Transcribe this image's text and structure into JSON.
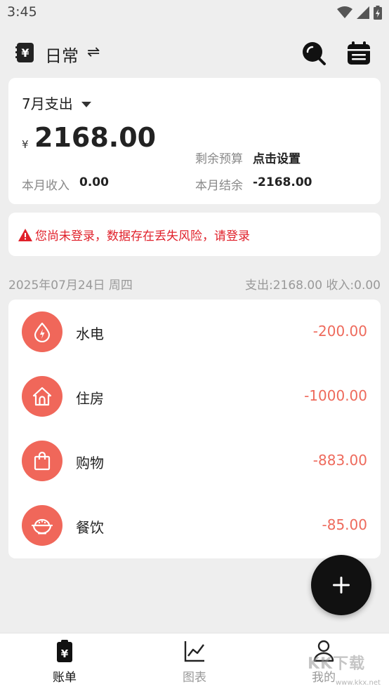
{
  "status_bar": {
    "time": "3:45"
  },
  "header": {
    "title": "日常",
    "swap_glyph": "⇌",
    "book_glyph": "¥"
  },
  "summary": {
    "month_label": "7月支出",
    "currency": "¥",
    "total": "2168.00",
    "budget_label": "剩余预算",
    "budget_action": "点击设置",
    "income_label": "本月收入",
    "income_value": "0.00",
    "balance_label": "本月结余",
    "balance_value": "-2168.00"
  },
  "warning": {
    "icon": "warning-icon",
    "text": "您尚未登录，数据存在丢失风险，请登录"
  },
  "day": {
    "date": "2025年07月24日 周四",
    "totals": "支出:2168.00  收入:0.00"
  },
  "records": [
    {
      "label": "水电",
      "amount": "-200.00",
      "icon": "utilities-icon"
    },
    {
      "label": "住房",
      "amount": "-1000.00",
      "icon": "house-icon"
    },
    {
      "label": "购物",
      "amount": "-883.00",
      "icon": "shopping-bag-icon"
    },
    {
      "label": "餐饮",
      "amount": "-85.00",
      "icon": "food-bowl-icon"
    }
  ],
  "nav": [
    {
      "label": "账单",
      "icon": "bill-icon",
      "active": true
    },
    {
      "label": "图表",
      "icon": "chart-icon",
      "active": false
    },
    {
      "label": "我的",
      "icon": "profile-icon",
      "active": false
    }
  ],
  "watermark": {
    "text": "KK下载",
    "url": "www.kkx.net"
  },
  "colors": {
    "accent": "#f0675a",
    "amount": "#ee6a5c",
    "warning": "#e0202a",
    "background": "#eeeeee",
    "fab": "#111111"
  }
}
